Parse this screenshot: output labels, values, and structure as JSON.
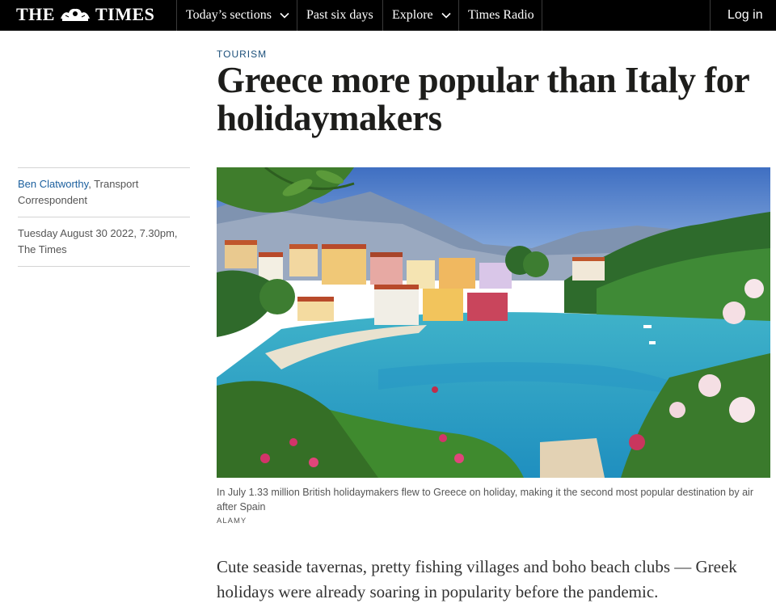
{
  "nav": {
    "logo_left": "THE",
    "logo_right": "TIMES",
    "sections_label": "Today’s sections",
    "past_label": "Past six days",
    "explore_label": "Explore",
    "radio_label": "Times Radio",
    "login_label": "Log in"
  },
  "article": {
    "section": "TOURISM",
    "headline": "Greece more popular than Italy for holidaymakers",
    "author": "Ben Clatworthy",
    "author_role": ", Transport Correspondent",
    "date": "Tuesday August 30 2022, 7.30pm, The Times",
    "caption": "In July 1.33 million British holidaymakers flew to Greece on holiday, making it the second most popular destination by air after Spain",
    "credit": "ALAMY",
    "intro": "Cute seaside tavernas, pretty fishing villages and boho beach clubs — Greek holidays were already soaring in popularity before the pandemic."
  },
  "colors": {
    "nav_bg": "#000000",
    "section_label": "#1b4f7a",
    "author_link": "#1b5f9e"
  },
  "icons": {
    "crest": "crest-icon",
    "chevron": "chevron-down-icon"
  }
}
